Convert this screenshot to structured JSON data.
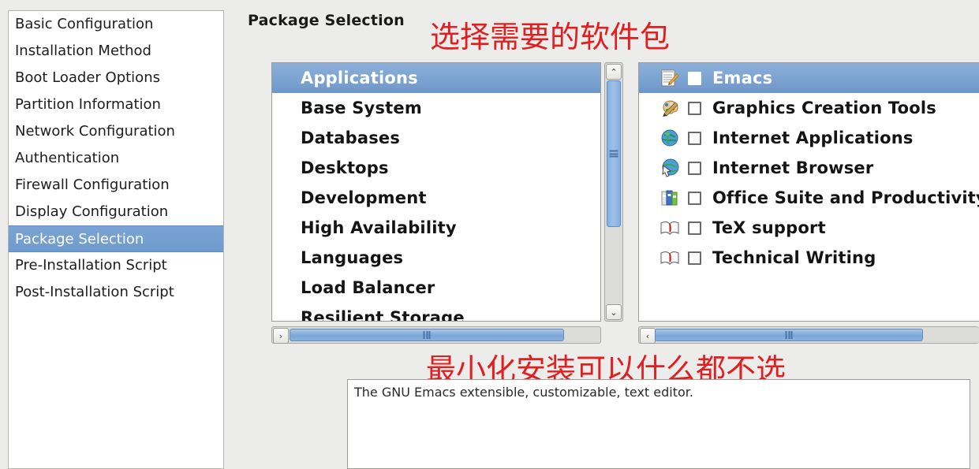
{
  "sidebar": {
    "items": [
      {
        "label": "Basic Configuration",
        "selected": false
      },
      {
        "label": "Installation Method",
        "selected": false
      },
      {
        "label": "Boot Loader Options",
        "selected": false
      },
      {
        "label": "Partition Information",
        "selected": false
      },
      {
        "label": "Network Configuration",
        "selected": false
      },
      {
        "label": "Authentication",
        "selected": false
      },
      {
        "label": "Firewall Configuration",
        "selected": false
      },
      {
        "label": "Display Configuration",
        "selected": false
      },
      {
        "label": "Package Selection",
        "selected": true
      },
      {
        "label": "Pre-Installation Script",
        "selected": false
      },
      {
        "label": "Post-Installation Script",
        "selected": false
      }
    ]
  },
  "header": {
    "title": "Package Selection"
  },
  "annotations": {
    "top": "选择需要的软件包",
    "bottom": "最小化安装可以什么都不选",
    "color": "#e02020"
  },
  "categories": {
    "items": [
      {
        "label": "Applications",
        "selected": true
      },
      {
        "label": "Base System",
        "selected": false
      },
      {
        "label": "Databases",
        "selected": false
      },
      {
        "label": "Desktops",
        "selected": false
      },
      {
        "label": "Development",
        "selected": false
      },
      {
        "label": "High Availability",
        "selected": false
      },
      {
        "label": "Languages",
        "selected": false
      },
      {
        "label": "Load Balancer",
        "selected": false
      },
      {
        "label": "Resilient Storage",
        "selected": false
      }
    ],
    "scroll_left_arrow": "‹",
    "scroll_right_arrow": "›",
    "scroll_up_arrow": "⌃",
    "scroll_down_arrow": "⌄"
  },
  "groups": {
    "items": [
      {
        "label": "Emacs",
        "icon": "notepad-pencil-icon",
        "checked": false,
        "selected": true
      },
      {
        "label": "Graphics Creation Tools",
        "icon": "paint-palette-icon",
        "checked": false,
        "selected": false
      },
      {
        "label": "Internet Applications",
        "icon": "globe-icon",
        "checked": false,
        "selected": false
      },
      {
        "label": "Internet Browser",
        "icon": "globe-cursor-icon",
        "checked": false,
        "selected": false
      },
      {
        "label": "Office Suite and Productivity",
        "icon": "binders-icon",
        "checked": false,
        "selected": false
      },
      {
        "label": "TeX support",
        "icon": "open-book-icon",
        "checked": false,
        "selected": false
      },
      {
        "label": "Technical Writing",
        "icon": "open-book-icon",
        "checked": false,
        "selected": false
      }
    ],
    "scroll_left_arrow": "‹"
  },
  "description": {
    "text": "The GNU Emacs extensible, customizable, text editor."
  },
  "colors": {
    "selection_blue": "#6e97c9",
    "panel_background": "#ececea",
    "list_background": "#ffffff",
    "annotation_red": "#e02020"
  }
}
